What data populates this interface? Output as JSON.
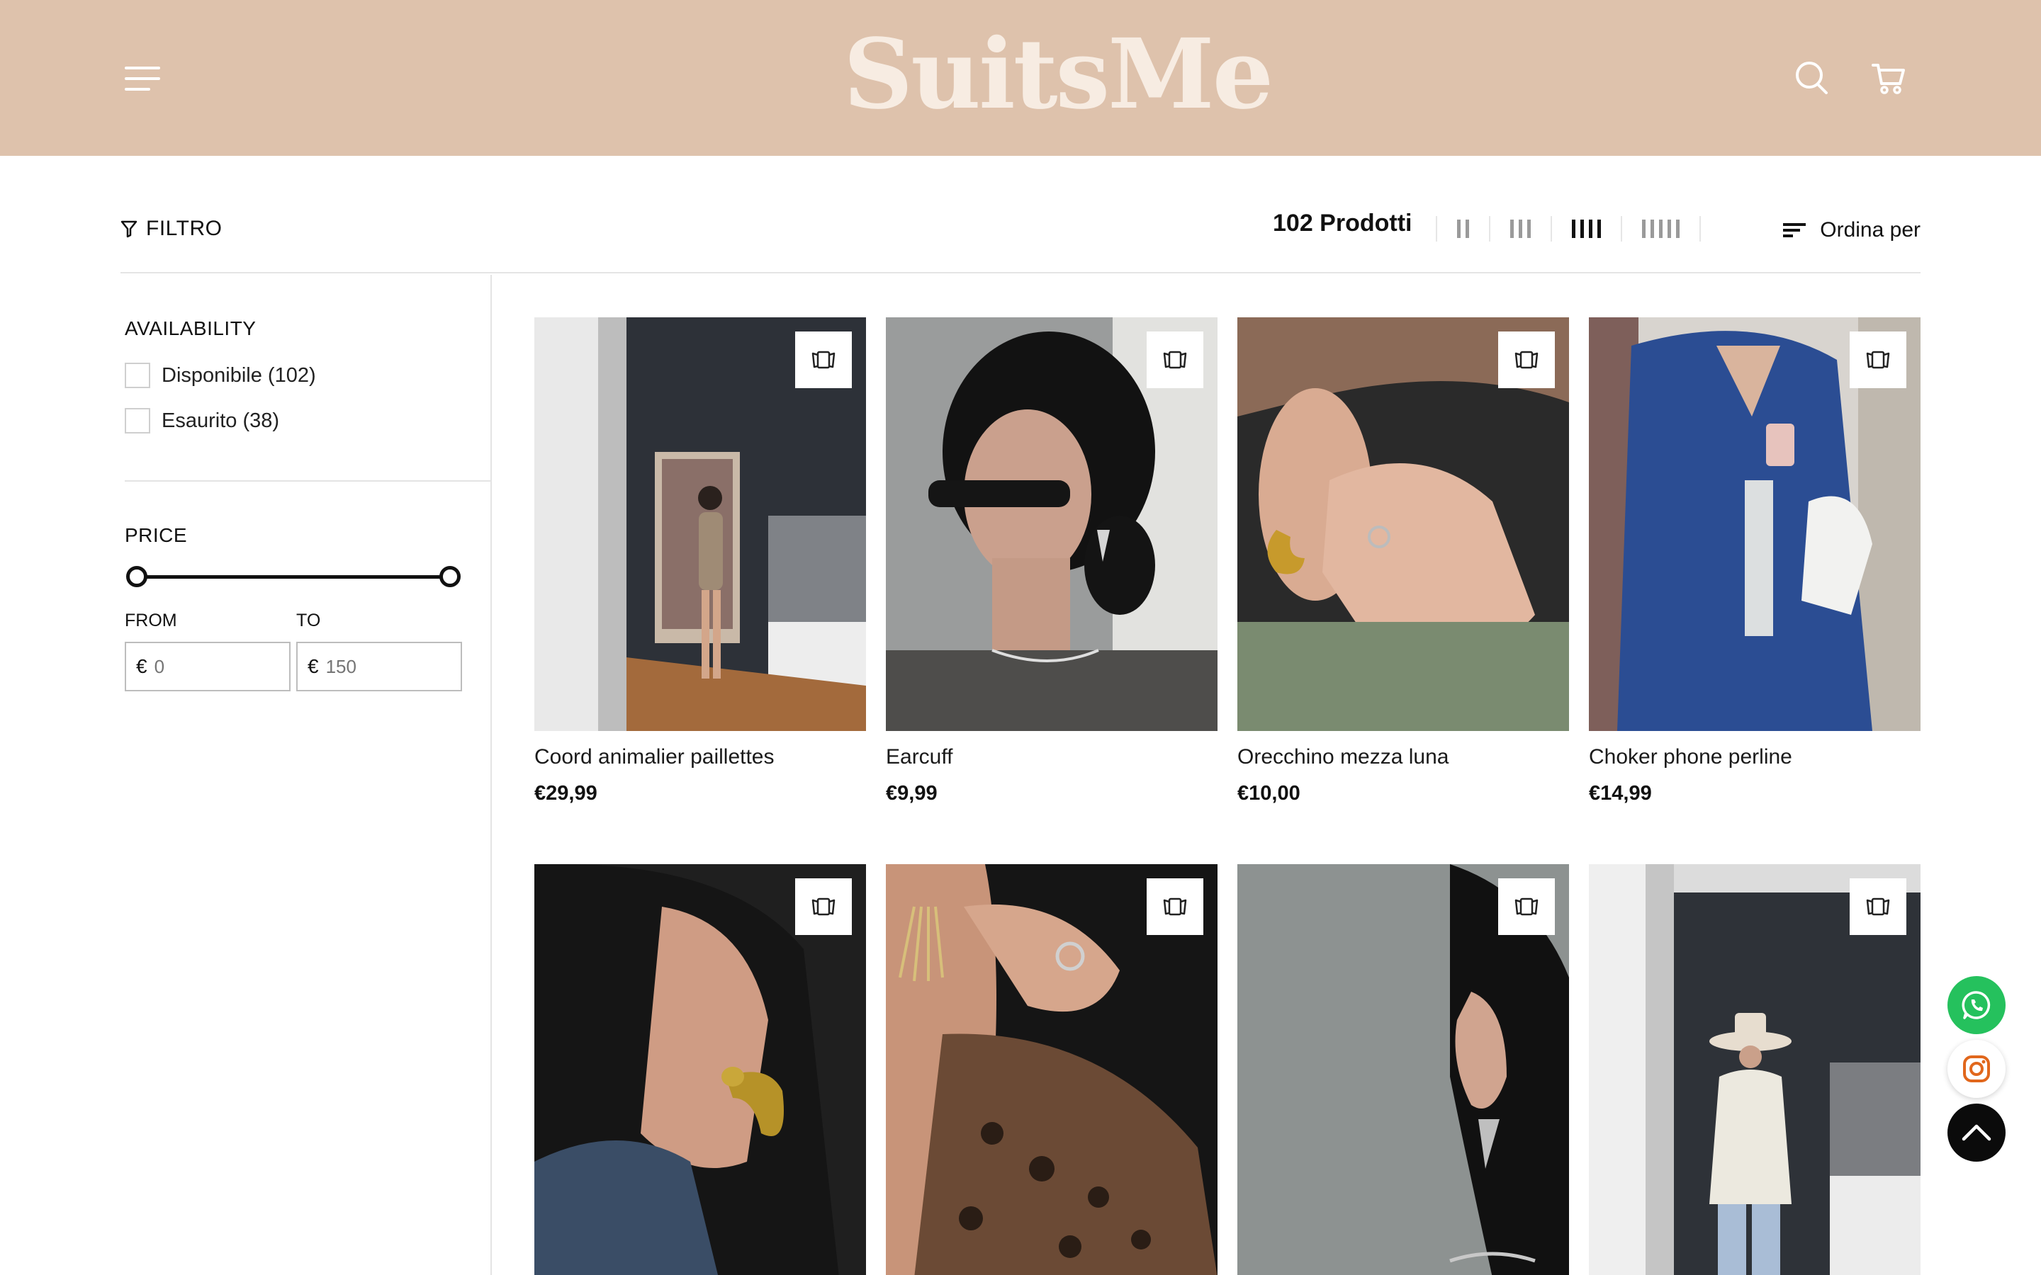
{
  "header": {
    "logo": "SuitsMe",
    "bg_color": "#dec2ac",
    "icons": [
      "menu-icon",
      "search-icon",
      "cart-icon"
    ]
  },
  "toolbar": {
    "filter_label": "FILTRO",
    "product_count": "102 Prodotti",
    "grid_options": [
      2,
      3,
      4,
      5
    ],
    "active_grid": 4,
    "sort_label": "Ordina per"
  },
  "sidebar": {
    "availability": {
      "title": "AVAILABILITY",
      "options": [
        {
          "label": "Disponibile (102)",
          "checked": false
        },
        {
          "label": "Esaurito (38)",
          "checked": false
        }
      ]
    },
    "price": {
      "title": "PRICE",
      "from_label": "FROM",
      "to_label": "TO",
      "currency": "€",
      "from_value": "0",
      "to_value": "150",
      "range_min": 0,
      "range_max": 150,
      "selected_min": 0,
      "selected_max": 150
    }
  },
  "products": [
    {
      "name": "Coord animalier paillettes",
      "price": "€29,99"
    },
    {
      "name": "Earcuff",
      "price": "€9,99"
    },
    {
      "name": "Orecchino mezza luna",
      "price": "€10,00"
    },
    {
      "name": "Choker phone perline",
      "price": "€14,99"
    },
    {
      "name": "",
      "price": ""
    },
    {
      "name": "",
      "price": ""
    },
    {
      "name": "",
      "price": ""
    },
    {
      "name": "",
      "price": ""
    }
  ],
  "floating": {
    "whatsapp_color": "#25c15d",
    "instagram_color": "#e1671c",
    "icons": [
      "whatsapp-icon",
      "instagram-icon",
      "chevron-up-icon"
    ]
  }
}
